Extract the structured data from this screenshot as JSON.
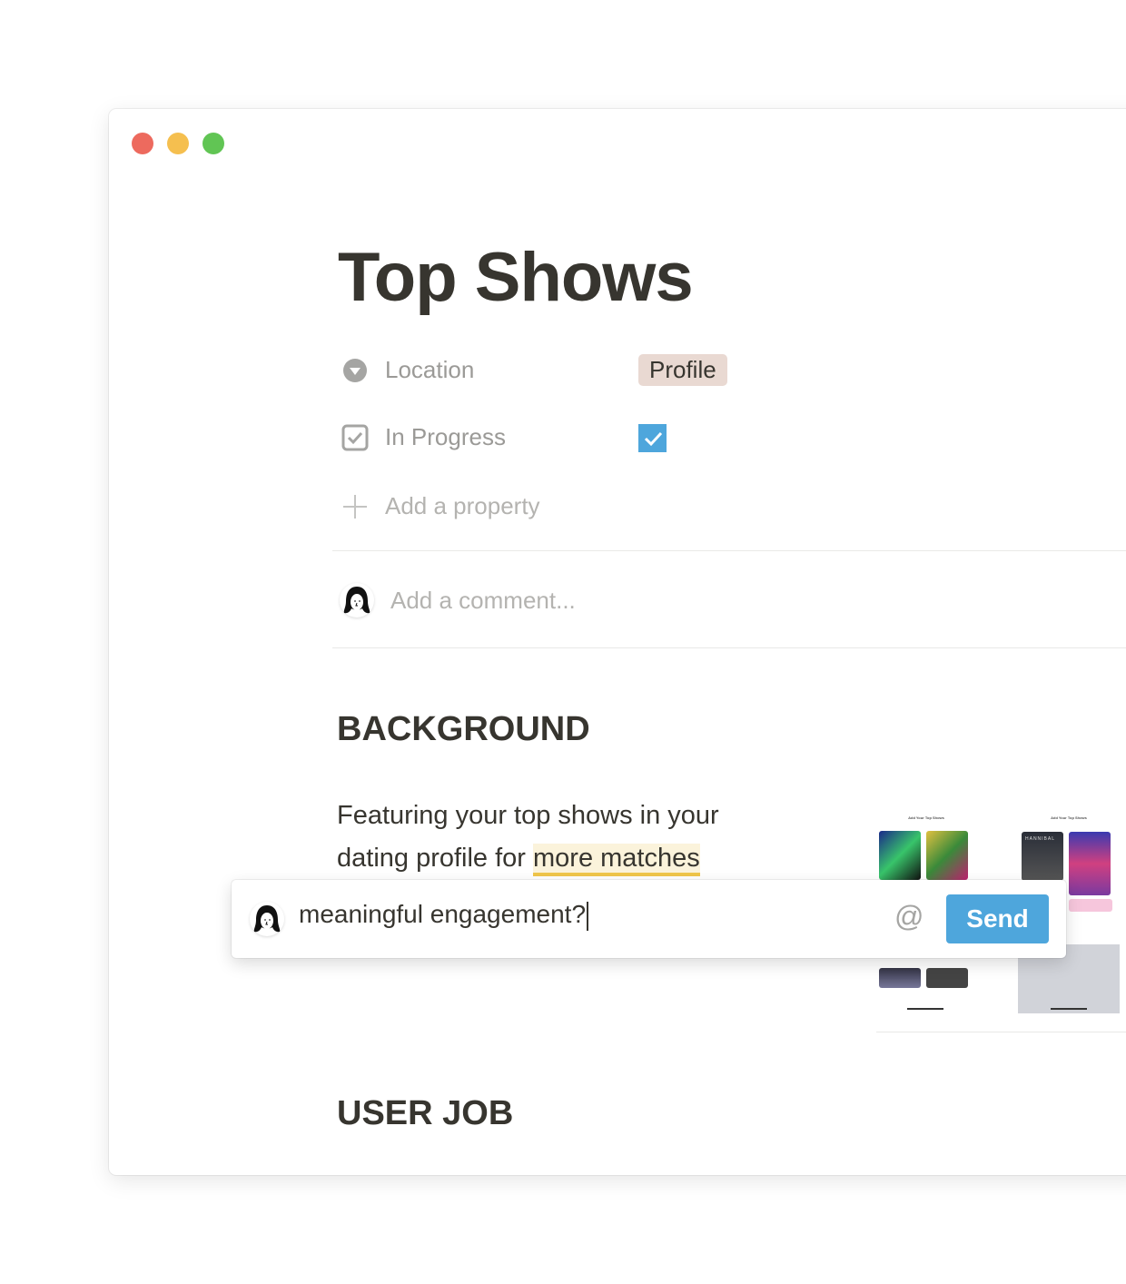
{
  "window": {
    "traffic_lights": {
      "close": "#ed6a5e",
      "minimize": "#f5bf4f",
      "maximize": "#61c554"
    }
  },
  "page": {
    "title": "Top Shows",
    "properties": [
      {
        "icon": "select-icon",
        "label": "Location",
        "value": "Profile",
        "tag_color": "#e9d9d2"
      },
      {
        "icon": "checkbox-icon",
        "label": "In Progress",
        "checked": true,
        "check_color": "#4ea6dc"
      }
    ],
    "add_property_label": "Add a property",
    "comment_placeholder": "Add a comment...",
    "sections": [
      {
        "heading": "BACKGROUND",
        "text_before": "Featuring your top shows in your dating profile for ",
        "highlighted": "more matches"
      },
      {
        "heading": "USER JOB"
      }
    ],
    "image": {
      "screens": [
        {
          "title": "Add Your Top Shows"
        },
        {
          "title": "Add Your Top Shows",
          "poster_label": "HANNIBAL"
        }
      ]
    }
  },
  "comment_popup": {
    "value": "meaningful engagement?",
    "mention_icon": "@",
    "send_label": "Send",
    "accent": "#4ea6dc",
    "highlight_underline": "#f0c64a"
  }
}
